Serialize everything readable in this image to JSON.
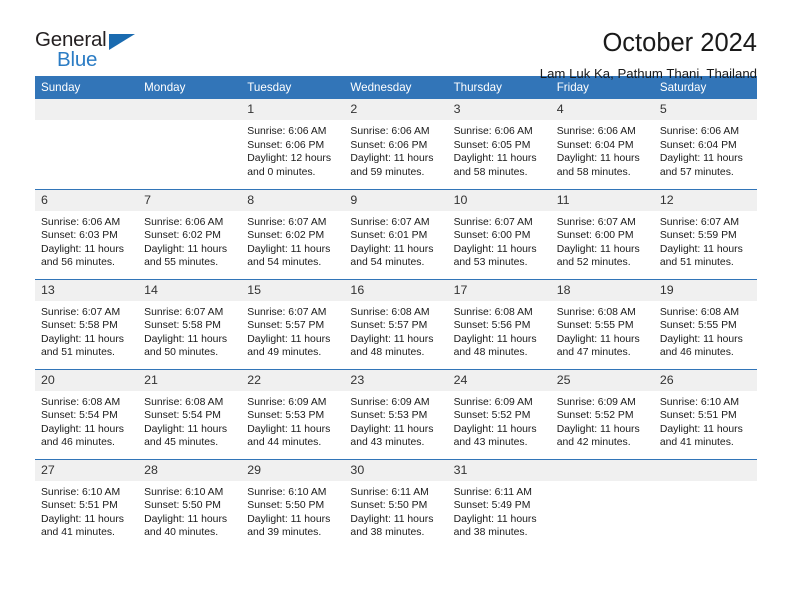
{
  "brand": {
    "name_primary": "General",
    "name_secondary": "Blue",
    "logo_icon": "triangle-icon"
  },
  "header": {
    "title": "October 2024",
    "subtitle": "Lam Luk Ka, Pathum Thani, Thailand"
  },
  "colors": {
    "header_blue": "#3275b8",
    "logo_blue": "#2b7cc4",
    "daynum_band": "#f0f0f0",
    "text": "#1a1a1a"
  },
  "calendar": {
    "weekday_headers": [
      "Sunday",
      "Monday",
      "Tuesday",
      "Wednesday",
      "Thursday",
      "Friday",
      "Saturday"
    ],
    "labels": {
      "sunrise": "Sunrise:",
      "sunset": "Sunset:",
      "daylight": "Daylight:"
    },
    "weeks": [
      [
        {
          "day": "",
          "empty": true
        },
        {
          "day": "",
          "empty": true
        },
        {
          "day": "1",
          "sunrise": "Sunrise: 6:06 AM",
          "sunset": "Sunset: 6:06 PM",
          "daylight": "Daylight: 12 hours and 0 minutes."
        },
        {
          "day": "2",
          "sunrise": "Sunrise: 6:06 AM",
          "sunset": "Sunset: 6:06 PM",
          "daylight": "Daylight: 11 hours and 59 minutes."
        },
        {
          "day": "3",
          "sunrise": "Sunrise: 6:06 AM",
          "sunset": "Sunset: 6:05 PM",
          "daylight": "Daylight: 11 hours and 58 minutes."
        },
        {
          "day": "4",
          "sunrise": "Sunrise: 6:06 AM",
          "sunset": "Sunset: 6:04 PM",
          "daylight": "Daylight: 11 hours and 58 minutes."
        },
        {
          "day": "5",
          "sunrise": "Sunrise: 6:06 AM",
          "sunset": "Sunset: 6:04 PM",
          "daylight": "Daylight: 11 hours and 57 minutes."
        }
      ],
      [
        {
          "day": "6",
          "sunrise": "Sunrise: 6:06 AM",
          "sunset": "Sunset: 6:03 PM",
          "daylight": "Daylight: 11 hours and 56 minutes."
        },
        {
          "day": "7",
          "sunrise": "Sunrise: 6:06 AM",
          "sunset": "Sunset: 6:02 PM",
          "daylight": "Daylight: 11 hours and 55 minutes."
        },
        {
          "day": "8",
          "sunrise": "Sunrise: 6:07 AM",
          "sunset": "Sunset: 6:02 PM",
          "daylight": "Daylight: 11 hours and 54 minutes."
        },
        {
          "day": "9",
          "sunrise": "Sunrise: 6:07 AM",
          "sunset": "Sunset: 6:01 PM",
          "daylight": "Daylight: 11 hours and 54 minutes."
        },
        {
          "day": "10",
          "sunrise": "Sunrise: 6:07 AM",
          "sunset": "Sunset: 6:00 PM",
          "daylight": "Daylight: 11 hours and 53 minutes."
        },
        {
          "day": "11",
          "sunrise": "Sunrise: 6:07 AM",
          "sunset": "Sunset: 6:00 PM",
          "daylight": "Daylight: 11 hours and 52 minutes."
        },
        {
          "day": "12",
          "sunrise": "Sunrise: 6:07 AM",
          "sunset": "Sunset: 5:59 PM",
          "daylight": "Daylight: 11 hours and 51 minutes."
        }
      ],
      [
        {
          "day": "13",
          "sunrise": "Sunrise: 6:07 AM",
          "sunset": "Sunset: 5:58 PM",
          "daylight": "Daylight: 11 hours and 51 minutes."
        },
        {
          "day": "14",
          "sunrise": "Sunrise: 6:07 AM",
          "sunset": "Sunset: 5:58 PM",
          "daylight": "Daylight: 11 hours and 50 minutes."
        },
        {
          "day": "15",
          "sunrise": "Sunrise: 6:07 AM",
          "sunset": "Sunset: 5:57 PM",
          "daylight": "Daylight: 11 hours and 49 minutes."
        },
        {
          "day": "16",
          "sunrise": "Sunrise: 6:08 AM",
          "sunset": "Sunset: 5:57 PM",
          "daylight": "Daylight: 11 hours and 48 minutes."
        },
        {
          "day": "17",
          "sunrise": "Sunrise: 6:08 AM",
          "sunset": "Sunset: 5:56 PM",
          "daylight": "Daylight: 11 hours and 48 minutes."
        },
        {
          "day": "18",
          "sunrise": "Sunrise: 6:08 AM",
          "sunset": "Sunset: 5:55 PM",
          "daylight": "Daylight: 11 hours and 47 minutes."
        },
        {
          "day": "19",
          "sunrise": "Sunrise: 6:08 AM",
          "sunset": "Sunset: 5:55 PM",
          "daylight": "Daylight: 11 hours and 46 minutes."
        }
      ],
      [
        {
          "day": "20",
          "sunrise": "Sunrise: 6:08 AM",
          "sunset": "Sunset: 5:54 PM",
          "daylight": "Daylight: 11 hours and 46 minutes."
        },
        {
          "day": "21",
          "sunrise": "Sunrise: 6:08 AM",
          "sunset": "Sunset: 5:54 PM",
          "daylight": "Daylight: 11 hours and 45 minutes."
        },
        {
          "day": "22",
          "sunrise": "Sunrise: 6:09 AM",
          "sunset": "Sunset: 5:53 PM",
          "daylight": "Daylight: 11 hours and 44 minutes."
        },
        {
          "day": "23",
          "sunrise": "Sunrise: 6:09 AM",
          "sunset": "Sunset: 5:53 PM",
          "daylight": "Daylight: 11 hours and 43 minutes."
        },
        {
          "day": "24",
          "sunrise": "Sunrise: 6:09 AM",
          "sunset": "Sunset: 5:52 PM",
          "daylight": "Daylight: 11 hours and 43 minutes."
        },
        {
          "day": "25",
          "sunrise": "Sunrise: 6:09 AM",
          "sunset": "Sunset: 5:52 PM",
          "daylight": "Daylight: 11 hours and 42 minutes."
        },
        {
          "day": "26",
          "sunrise": "Sunrise: 6:10 AM",
          "sunset": "Sunset: 5:51 PM",
          "daylight": "Daylight: 11 hours and 41 minutes."
        }
      ],
      [
        {
          "day": "27",
          "sunrise": "Sunrise: 6:10 AM",
          "sunset": "Sunset: 5:51 PM",
          "daylight": "Daylight: 11 hours and 41 minutes."
        },
        {
          "day": "28",
          "sunrise": "Sunrise: 6:10 AM",
          "sunset": "Sunset: 5:50 PM",
          "daylight": "Daylight: 11 hours and 40 minutes."
        },
        {
          "day": "29",
          "sunrise": "Sunrise: 6:10 AM",
          "sunset": "Sunset: 5:50 PM",
          "daylight": "Daylight: 11 hours and 39 minutes."
        },
        {
          "day": "30",
          "sunrise": "Sunrise: 6:11 AM",
          "sunset": "Sunset: 5:50 PM",
          "daylight": "Daylight: 11 hours and 38 minutes."
        },
        {
          "day": "31",
          "sunrise": "Sunrise: 6:11 AM",
          "sunset": "Sunset: 5:49 PM",
          "daylight": "Daylight: 11 hours and 38 minutes."
        },
        {
          "day": "",
          "empty": true
        },
        {
          "day": "",
          "empty": true
        }
      ]
    ]
  }
}
